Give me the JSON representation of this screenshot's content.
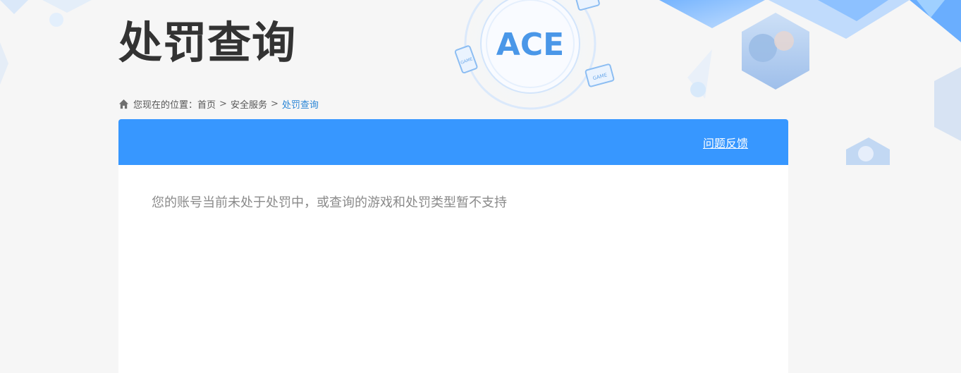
{
  "page": {
    "title": "处罚查询"
  },
  "logo": {
    "text": "ACE",
    "badge_left": "GAME",
    "badge_right": "GAME"
  },
  "breadcrumb": {
    "prefix": "您现在的位置：",
    "items": [
      "首页",
      "安全服务"
    ],
    "current": "处罚查询",
    "separator": ">"
  },
  "panel": {
    "feedback_label": "问题反馈",
    "message": "您的账号当前未处于处罚中，或查询的游戏和处罚类型暂不支持"
  },
  "colors": {
    "accent": "#3797ff",
    "link_current": "#2b86d6",
    "background": "#f6f6f6"
  },
  "icons": {
    "home": "home-icon"
  }
}
